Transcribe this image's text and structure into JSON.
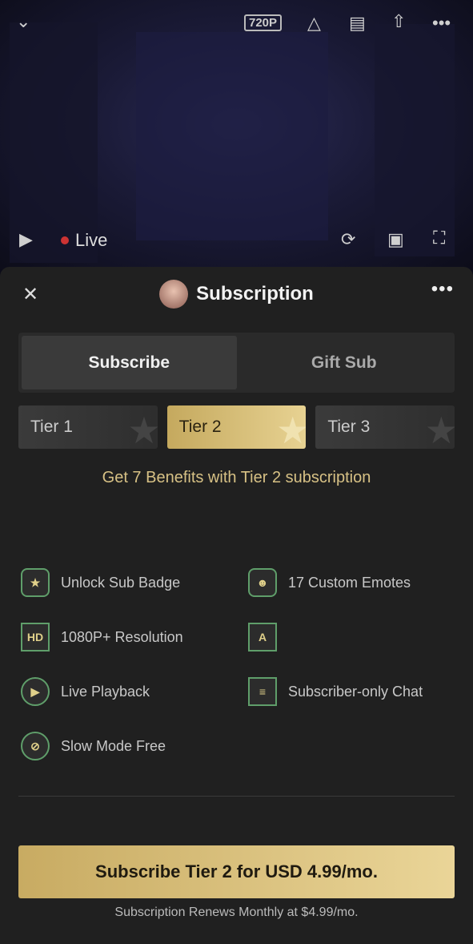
{
  "player": {
    "quality": "720P",
    "live_label": "Live"
  },
  "panel": {
    "title": "Subscription",
    "tabs": [
      {
        "label": "Subscribe",
        "active": true
      },
      {
        "label": "Gift Sub",
        "active": false
      }
    ],
    "tiers": [
      {
        "label": "Tier 1"
      },
      {
        "label": "Tier 2",
        "selected": true
      },
      {
        "label": "Tier 3"
      }
    ],
    "benefits_heading": "Get 7 Benefits with Tier 2 subscription",
    "benefits": [
      {
        "icon": "badge-star-icon",
        "label": "Unlock Sub Badge"
      },
      {
        "icon": "emote-icon",
        "label": "17 Custom Emotes"
      },
      {
        "icon": "hd-icon",
        "label": "1080P+ Resolution",
        "glyph": "HD"
      },
      {
        "icon": "chat-a-icon",
        "label": "",
        "glyph": "A"
      },
      {
        "icon": "playback-icon",
        "label": "Live Playback"
      },
      {
        "icon": "sub-chat-icon",
        "label": "Subscriber-only Chat"
      },
      {
        "icon": "slow-mode-free-icon",
        "label": "Slow Mode Free"
      }
    ],
    "cta": "Subscribe Tier 2 for USD 4.99/mo.",
    "renew_note": "Subscription Renews Monthly at $4.99/mo."
  },
  "colors": {
    "gold": "#d7c185",
    "icon_green": "#5f9e6a",
    "panel_bg": "#202020"
  }
}
